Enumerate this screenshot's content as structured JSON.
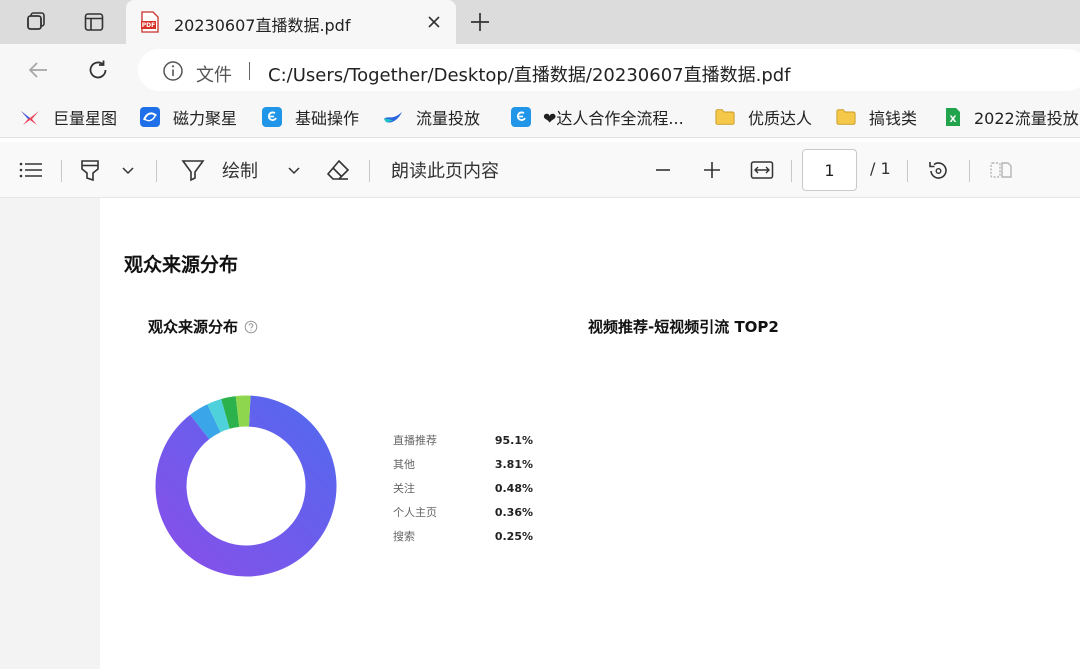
{
  "tab": {
    "title": "20230607直播数据.pdf",
    "favicon_text": "PDF"
  },
  "address": {
    "scheme_label": "文件",
    "url": "C:/Users/Together/Desktop/直播数据/20230607直播数据.pdf"
  },
  "bookmarks": [
    {
      "label": "巨量星图",
      "icon": "xingtu-logo-icon"
    },
    {
      "label": "磁力聚星",
      "icon": "cili-logo-icon"
    },
    {
      "label": "基础操作",
      "icon": "ocean-engine-icon"
    },
    {
      "label": "流量投放",
      "icon": "douyin-bird-icon"
    },
    {
      "label": "",
      "icon": "ocean-engine-icon"
    },
    {
      "label": "❤达人合作全流程...",
      "icon": ""
    },
    {
      "label": "优质达人",
      "icon": "folder-icon"
    },
    {
      "label": "搞钱类",
      "icon": "folder-icon"
    },
    {
      "label": "2022流量投放",
      "icon": "excel-icon"
    }
  ],
  "pdf_toolbar": {
    "draw_label": "绘制",
    "read_aloud_label": "朗读此页内容",
    "page_number": "1",
    "page_total": "/ 1"
  },
  "document": {
    "section_title": "观众来源分布",
    "card_title": "观众来源分布",
    "right_card_title": "视频推荐-短视频引流 TOP2"
  },
  "chart_data": {
    "type": "pie",
    "title": "观众来源分布",
    "categories": [
      "直播推荐",
      "其他",
      "关注",
      "个人主页",
      "搜索"
    ],
    "values": [
      95.1,
      3.81,
      0.48,
      0.36,
      0.25
    ],
    "labels": [
      "95.1%",
      "3.81%",
      "0.48%",
      "0.36%",
      "0.25%"
    ],
    "colors": [
      "#5b63ec",
      "#3aa5e8",
      "#4fd1dc",
      "#2bb24c",
      "#8fd64f"
    ],
    "legend": "right"
  }
}
